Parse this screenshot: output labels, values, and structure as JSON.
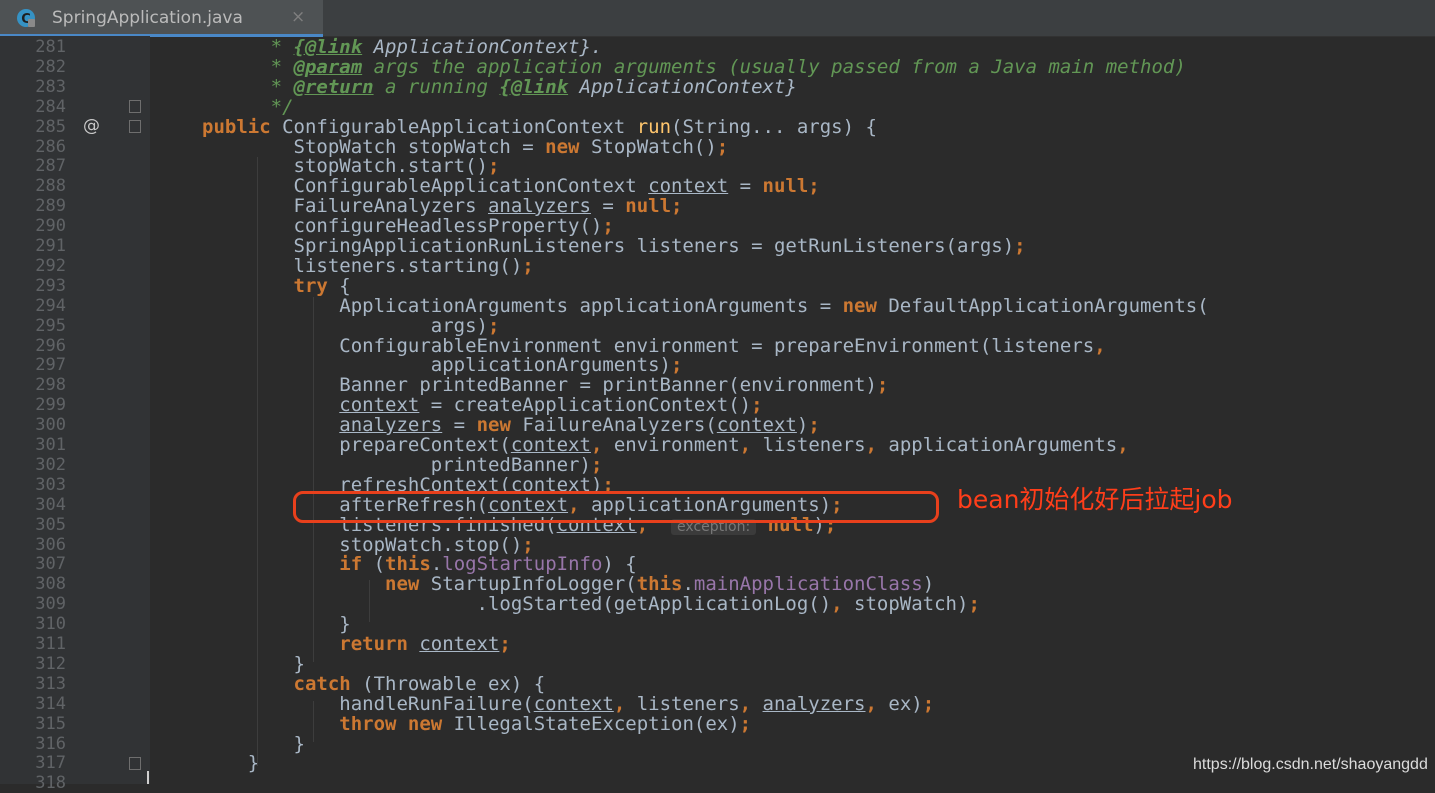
{
  "tab": {
    "file_icon": "class-icon",
    "title": "SpringApplication.java",
    "close_glyph": "×"
  },
  "gutter": {
    "override_marker": "@"
  },
  "lines": [
    {
      "n": "281",
      "seg": [
        [
          "c",
          "      * "
        ],
        [
          "ct",
          "{@link"
        ],
        [
          "cb",
          " ApplicationContext}."
        ]
      ]
    },
    {
      "n": "282",
      "seg": [
        [
          "c",
          "      * "
        ],
        [
          "ct",
          "@param"
        ],
        [
          "c",
          " args the application arguments (usually passed from a Java main method)"
        ]
      ]
    },
    {
      "n": "283",
      "seg": [
        [
          "c",
          "      * "
        ],
        [
          "ct",
          "@return"
        ],
        [
          "c",
          " a running "
        ],
        [
          "ct",
          "{@link"
        ],
        [
          "cb",
          " ApplicationContext}"
        ]
      ]
    },
    {
      "n": "284",
      "seg": [
        [
          "c",
          "      */"
        ]
      ]
    },
    {
      "n": "285",
      "seg": [
        [
          "k",
          "public "
        ],
        [
          "t",
          "ConfigurableApplicationContext "
        ],
        [
          "m",
          "run"
        ],
        [
          "t",
          "(String... args) {"
        ]
      ]
    },
    {
      "n": "286",
      "seg": [
        [
          "t",
          "        StopWatch stopWatch = "
        ],
        [
          "k",
          "new "
        ],
        [
          "t",
          "StopWatch()"
        ],
        [
          "k",
          ";"
        ]
      ]
    },
    {
      "n": "287",
      "seg": [
        [
          "t",
          "        stopWatch.start()"
        ],
        [
          "k",
          ";"
        ]
      ]
    },
    {
      "n": "288",
      "seg": [
        [
          "t",
          "        ConfigurableApplicationContext "
        ],
        [
          "u",
          "context"
        ],
        [
          "t",
          " = "
        ],
        [
          "k",
          "null;"
        ]
      ]
    },
    {
      "n": "289",
      "seg": [
        [
          "t",
          "        FailureAnalyzers "
        ],
        [
          "u",
          "analyzers"
        ],
        [
          "t",
          " = "
        ],
        [
          "k",
          "null;"
        ]
      ]
    },
    {
      "n": "290",
      "seg": [
        [
          "t",
          "        configureHeadlessProperty()"
        ],
        [
          "k",
          ";"
        ]
      ]
    },
    {
      "n": "291",
      "seg": [
        [
          "t",
          "        SpringApplicationRunListeners listeners = getRunListeners(args)"
        ],
        [
          "k",
          ";"
        ]
      ]
    },
    {
      "n": "292",
      "seg": [
        [
          "t",
          "        listeners.starting()"
        ],
        [
          "k",
          ";"
        ]
      ]
    },
    {
      "n": "293",
      "seg": [
        [
          "k",
          "        try "
        ],
        [
          "t",
          "{"
        ]
      ]
    },
    {
      "n": "294",
      "seg": [
        [
          "t",
          "            ApplicationArguments applicationArguments = "
        ],
        [
          "k",
          "new "
        ],
        [
          "t",
          "DefaultApplicationArguments("
        ]
      ]
    },
    {
      "n": "295",
      "seg": [
        [
          "t",
          "                    args)"
        ],
        [
          "k",
          ";"
        ]
      ]
    },
    {
      "n": "296",
      "seg": [
        [
          "t",
          "            ConfigurableEnvironment environment = prepareEnvironment(listeners"
        ],
        [
          "k",
          ","
        ]
      ]
    },
    {
      "n": "297",
      "seg": [
        [
          "t",
          "                    applicationArguments)"
        ],
        [
          "k",
          ";"
        ]
      ]
    },
    {
      "n": "298",
      "seg": [
        [
          "t",
          "            Banner printedBanner = printBanner(environment)"
        ],
        [
          "k",
          ";"
        ]
      ]
    },
    {
      "n": "299",
      "seg": [
        [
          "t",
          "            "
        ],
        [
          "u",
          "context"
        ],
        [
          "t",
          " = createApplicationContext()"
        ],
        [
          "k",
          ";"
        ]
      ]
    },
    {
      "n": "300",
      "seg": [
        [
          "t",
          "            "
        ],
        [
          "u",
          "analyzers"
        ],
        [
          "t",
          " = "
        ],
        [
          "k",
          "new "
        ],
        [
          "t",
          "FailureAnalyzers("
        ],
        [
          "u",
          "context"
        ],
        [
          "t",
          ")"
        ],
        [
          "k",
          ";"
        ]
      ]
    },
    {
      "n": "301",
      "seg": [
        [
          "t",
          "            prepareContext("
        ],
        [
          "u",
          "context"
        ],
        [
          "k",
          ", "
        ],
        [
          "t",
          "environment"
        ],
        [
          "k",
          ", "
        ],
        [
          "t",
          "listeners"
        ],
        [
          "k",
          ", "
        ],
        [
          "t",
          "applicationArguments"
        ],
        [
          "k",
          ","
        ]
      ]
    },
    {
      "n": "302",
      "seg": [
        [
          "t",
          "                    printedBanner)"
        ],
        [
          "k",
          ";"
        ]
      ]
    },
    {
      "n": "303",
      "seg": [
        [
          "t",
          "            refreshContext("
        ],
        [
          "u",
          "context"
        ],
        [
          "t",
          ")"
        ],
        [
          "k",
          ";"
        ]
      ]
    },
    {
      "n": "304",
      "seg": [
        [
          "t",
          "            afterRefresh("
        ],
        [
          "u",
          "context"
        ],
        [
          "k",
          ", "
        ],
        [
          "t",
          "applicationArguments)"
        ],
        [
          "k",
          ";"
        ]
      ]
    },
    {
      "n": "305",
      "seg": [
        [
          "t",
          "            listeners.finished("
        ],
        [
          "u",
          "context"
        ],
        [
          "k",
          ", "
        ],
        [
          "t",
          " "
        ],
        [
          "h",
          "exception:"
        ],
        [
          "t",
          " "
        ],
        [
          "k",
          "null"
        ],
        [
          "t",
          ")"
        ],
        [
          "k",
          ";"
        ]
      ]
    },
    {
      "n": "306",
      "seg": [
        [
          "t",
          "            stopWatch.stop()"
        ],
        [
          "k",
          ";"
        ]
      ]
    },
    {
      "n": "307",
      "seg": [
        [
          "k",
          "            if "
        ],
        [
          "t",
          "("
        ],
        [
          "k",
          "this"
        ],
        [
          "t",
          "."
        ],
        [
          "f",
          "logStartupInfo"
        ],
        [
          "t",
          ") {"
        ]
      ]
    },
    {
      "n": "308",
      "seg": [
        [
          "k",
          "                new "
        ],
        [
          "t",
          "StartupInfoLogger("
        ],
        [
          "k",
          "this"
        ],
        [
          "t",
          "."
        ],
        [
          "f",
          "mainApplicationClass"
        ],
        [
          "t",
          ")"
        ]
      ]
    },
    {
      "n": "309",
      "seg": [
        [
          "t",
          "                        .logStarted(getApplicationLog()"
        ],
        [
          "k",
          ", "
        ],
        [
          "t",
          "stopWatch)"
        ],
        [
          "k",
          ";"
        ]
      ]
    },
    {
      "n": "310",
      "seg": [
        [
          "t",
          "            }"
        ]
      ]
    },
    {
      "n": "311",
      "seg": [
        [
          "k",
          "            return "
        ],
        [
          "u",
          "context"
        ],
        [
          "k",
          ";"
        ]
      ]
    },
    {
      "n": "312",
      "seg": [
        [
          "t",
          "        }"
        ]
      ]
    },
    {
      "n": "313",
      "seg": [
        [
          "k",
          "        catch "
        ],
        [
          "t",
          "(Throwable ex) {"
        ]
      ]
    },
    {
      "n": "314",
      "seg": [
        [
          "t",
          "            handleRunFailure("
        ],
        [
          "u",
          "context"
        ],
        [
          "k",
          ", "
        ],
        [
          "t",
          "listeners"
        ],
        [
          "k",
          ", "
        ],
        [
          "u",
          "analyzers"
        ],
        [
          "k",
          ", "
        ],
        [
          "t",
          "ex)"
        ],
        [
          "k",
          ";"
        ]
      ]
    },
    {
      "n": "315",
      "seg": [
        [
          "k",
          "            throw new "
        ],
        [
          "t",
          "IllegalStateException(ex)"
        ],
        [
          "k",
          ";"
        ]
      ]
    },
    {
      "n": "316",
      "seg": [
        [
          "t",
          "        }"
        ]
      ]
    },
    {
      "n": "317",
      "seg": [
        [
          "t",
          "    }"
        ]
      ]
    },
    {
      "n": "318",
      "seg": []
    }
  ],
  "annotation": {
    "text": "bean初始化好后拉起job",
    "color": "#ff3e1a"
  },
  "watermark": "https://blog.csdn.net/shaoyangdd",
  "colors": {
    "background": "#2b2b2b",
    "gutter": "#313335",
    "keyword": "#cc7832",
    "comment": "#629755",
    "field": "#9876aa",
    "method": "#ffc66d",
    "text": "#a9b7c6"
  }
}
